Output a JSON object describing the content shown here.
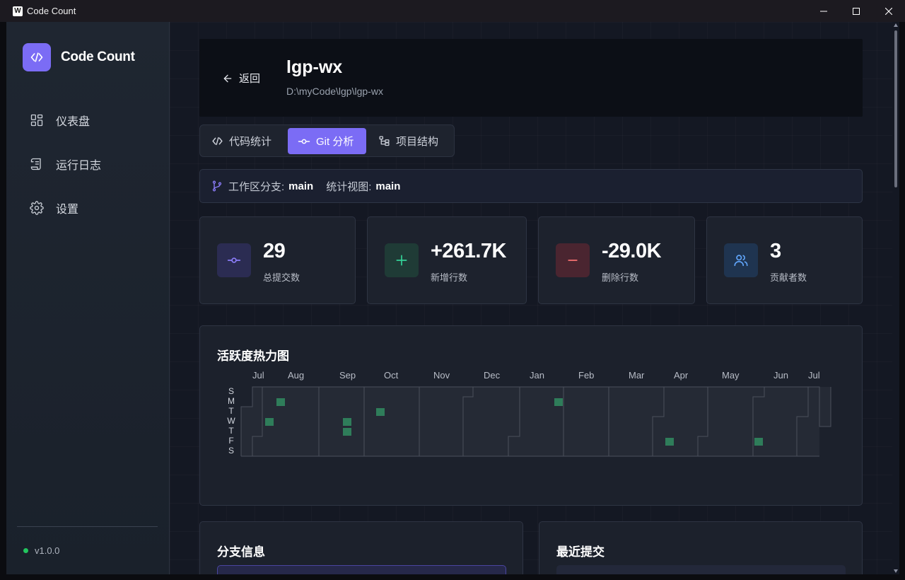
{
  "window": {
    "app_icon_letter": "W",
    "title": "Code Count"
  },
  "sidebar": {
    "brand": "Code Count",
    "items": [
      {
        "label": "仪表盘",
        "icon": "dashboard-icon"
      },
      {
        "label": "运行日志",
        "icon": "scroll-icon"
      },
      {
        "label": "设置",
        "icon": "gear-icon"
      }
    ],
    "version": "v1.0.0",
    "version_status_color": "#22c55e"
  },
  "header": {
    "back_label": "返回",
    "project_name": "lgp-wx",
    "project_path": "D:\\myCode\\lgp\\lgp-wx"
  },
  "tabs": [
    {
      "label": "代码统计",
      "icon": "code-icon",
      "active": false
    },
    {
      "label": "Git 分析",
      "icon": "git-commit-icon",
      "active": true
    },
    {
      "label": "项目结构",
      "icon": "tree-icon",
      "active": false
    }
  ],
  "branch_bar": {
    "workspace_label": "工作区分支:",
    "workspace_branch": "main",
    "view_label": "统计视图:",
    "view_branch": "main"
  },
  "stats": [
    {
      "value": "29",
      "label": "总提交数",
      "icon": "git-commit-icon",
      "color": "#8b7cf8"
    },
    {
      "value": "+261.7K",
      "label": "新增行数",
      "icon": "plus-icon",
      "color": "#34d399"
    },
    {
      "value": "-29.0K",
      "label": "删除行数",
      "icon": "minus-icon",
      "color": "#f87171"
    },
    {
      "value": "3",
      "label": "贡献者数",
      "icon": "users-icon",
      "color": "#60a5fa"
    }
  ],
  "heatmap": {
    "title": "活跃度热力图",
    "months": [
      "Jul",
      "Aug",
      "Sep",
      "Oct",
      "Nov",
      "Dec",
      "Jan",
      "Feb",
      "Mar",
      "Apr",
      "May",
      "Jun",
      "Jul"
    ],
    "weekdays": [
      "S",
      "M",
      "T",
      "W",
      "T",
      "F",
      "S"
    ],
    "active_color": "#2f7d5a"
  },
  "branches_card": {
    "title": "分支信息"
  },
  "commits_card": {
    "title": "最近提交"
  },
  "colors": {
    "accent": "#7b6cf5",
    "background": "#141823"
  }
}
